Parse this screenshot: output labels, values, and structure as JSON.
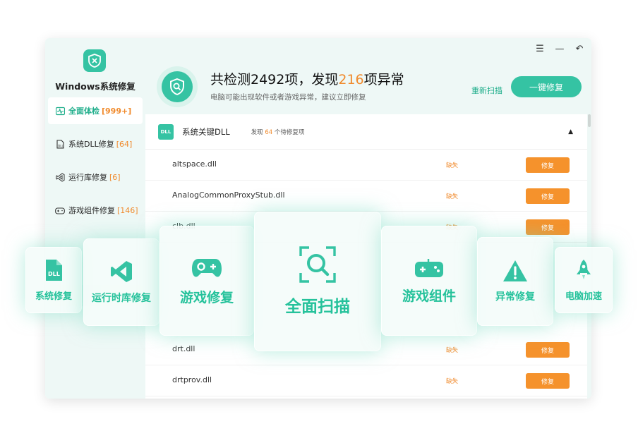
{
  "app": {
    "title": "Windows系统修复"
  },
  "sidebar": {
    "items": [
      {
        "label": "全面体检",
        "count": "[999+]"
      },
      {
        "label": "系统DLL修复",
        "count": "[64]"
      },
      {
        "label": "运行库修复",
        "count": "[6]"
      },
      {
        "label": "游戏组件修复",
        "count": "[146]"
      }
    ]
  },
  "window_controls": {
    "menu": "☰",
    "minimize": "—",
    "back": "↶"
  },
  "header": {
    "headline_prefix": "共检测2492项，发现",
    "headline_count": "216",
    "headline_suffix": "项异常",
    "subline": "电脑可能出现软件或者游戏异常，建议立即修复",
    "rescan_label": "重新扫描",
    "fix_all_label": "一键修复"
  },
  "section": {
    "badge": "DLL",
    "title": "系统关键DLL",
    "found_prefix": "发现",
    "found_count": "64",
    "found_suffix": "个待修复项",
    "collapse_icon": "▲"
  },
  "rows": [
    {
      "name": "altspace.dll",
      "status": "缺失",
      "action": "修复"
    },
    {
      "name": "AnalogCommonProxyStub.dll",
      "status": "缺失",
      "action": "修复"
    },
    {
      "name": "clb.dll",
      "status": "缺失",
      "action": "修复"
    },
    {
      "name": "drt.dll",
      "status": "缺失",
      "action": "修复"
    },
    {
      "name": "drtprov.dll",
      "status": "缺失",
      "action": "修复"
    }
  ],
  "cards": [
    {
      "label": "系统修复",
      "icon": "dll-file-icon"
    },
    {
      "label": "运行时库修复",
      "icon": "visual-studio-icon"
    },
    {
      "label": "游戏修复",
      "icon": "gamepad-icon"
    },
    {
      "label": "全面扫描",
      "icon": "scan-magnifier-icon"
    },
    {
      "label": "游戏组件",
      "icon": "game-controller-icon"
    },
    {
      "label": "异常修复",
      "icon": "warning-icon"
    },
    {
      "label": "电脑加速",
      "icon": "rocket-icon"
    }
  ],
  "colors": {
    "accent": "#35c3a3",
    "warning": "#f08a2c",
    "fix_button": "#f5922c"
  }
}
